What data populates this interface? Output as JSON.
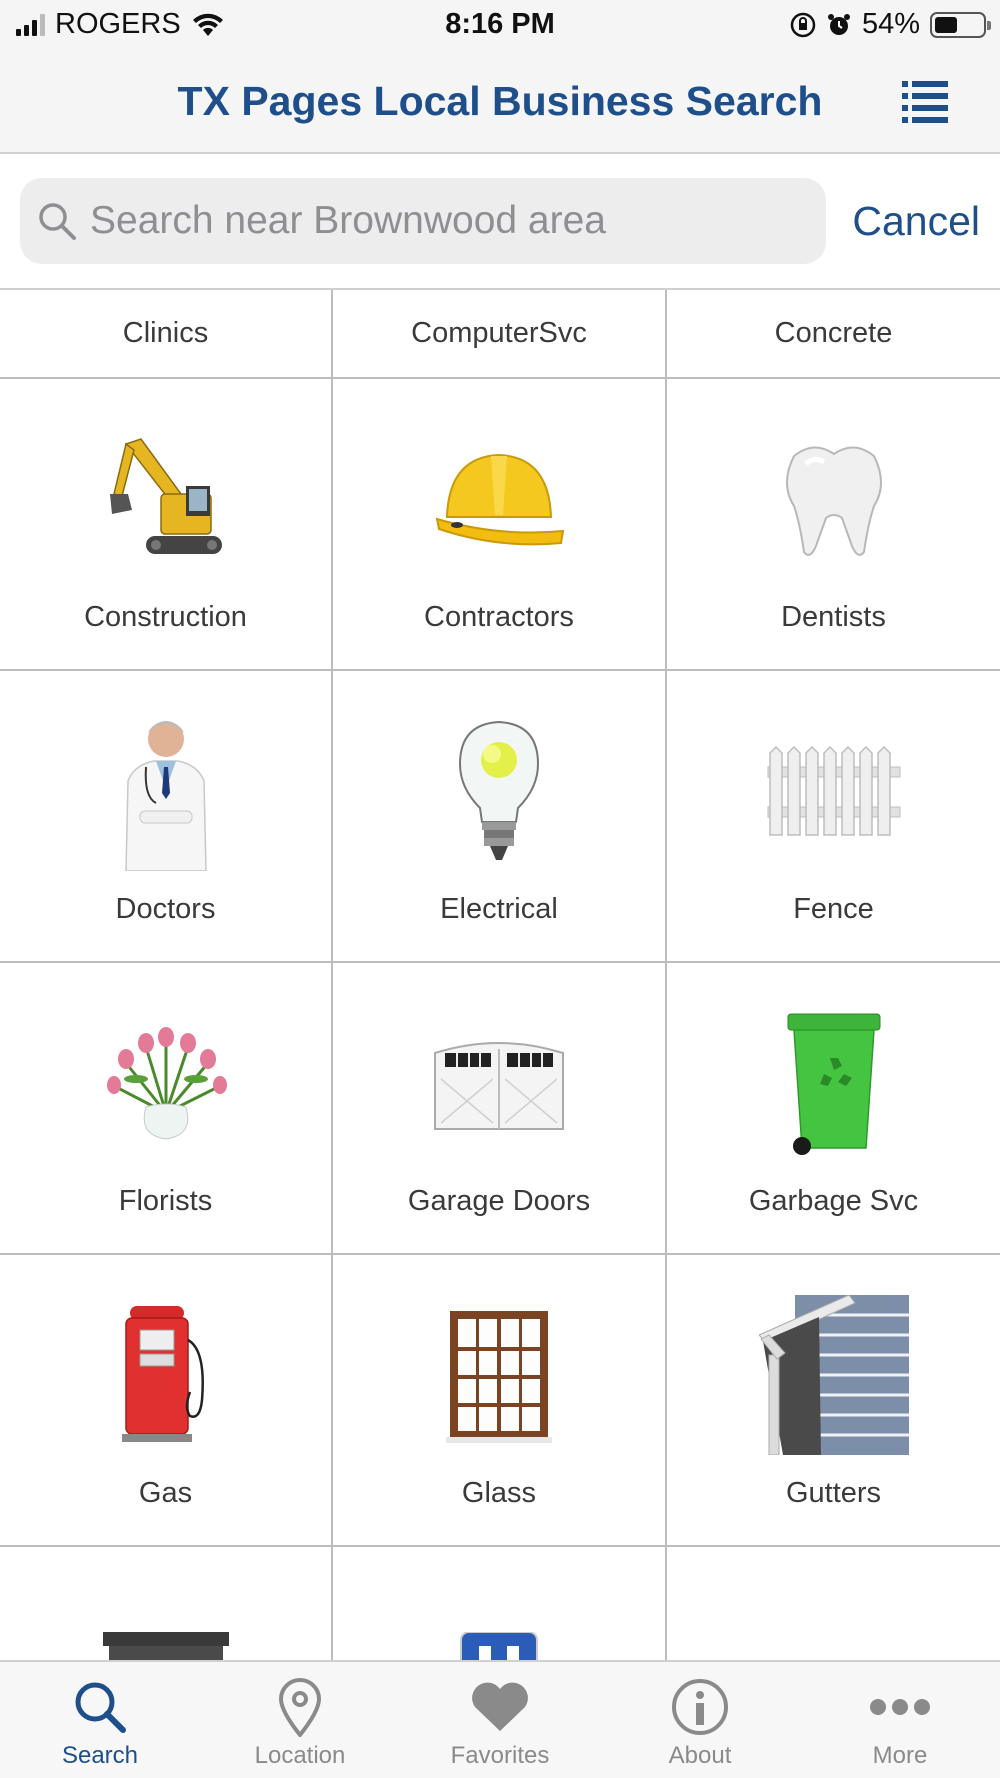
{
  "status_bar": {
    "carrier": "ROGERS",
    "time": "8:16 PM",
    "battery": "54%"
  },
  "nav": {
    "title": "TX Pages Local Business Search"
  },
  "search": {
    "placeholder": "Search near Brownwood area",
    "value": "",
    "cancel_label": "Cancel"
  },
  "top_row": [
    "Clinics",
    "ComputerSvc",
    "Concrete"
  ],
  "categories": [
    {
      "label": "Construction",
      "icon": "excavator-icon"
    },
    {
      "label": "Contractors",
      "icon": "hard-hat-icon"
    },
    {
      "label": "Dentists",
      "icon": "tooth-icon"
    },
    {
      "label": "Doctors",
      "icon": "doctor-icon"
    },
    {
      "label": "Electrical",
      "icon": "light-bulb-icon"
    },
    {
      "label": "Fence",
      "icon": "fence-icon"
    },
    {
      "label": "Florists",
      "icon": "flowers-icon"
    },
    {
      "label": "Garage Doors",
      "icon": "garage-door-icon"
    },
    {
      "label": "Garbage Svc",
      "icon": "garbage-bin-icon"
    },
    {
      "label": "Gas",
      "icon": "gas-pump-icon"
    },
    {
      "label": "Glass",
      "icon": "window-icon"
    },
    {
      "label": "Gutters",
      "icon": "gutter-icon"
    },
    {
      "label": "",
      "icon": "fireplace-icon"
    },
    {
      "label": "",
      "icon": "hospital-sign-icon"
    },
    {
      "label": "",
      "icon": "furniture-icon"
    }
  ],
  "tabs": [
    {
      "label": "Search",
      "icon": "search-icon",
      "active": true
    },
    {
      "label": "Location",
      "icon": "location-pin-icon",
      "active": false
    },
    {
      "label": "Favorites",
      "icon": "heart-icon",
      "active": false
    },
    {
      "label": "About",
      "icon": "info-icon",
      "active": false
    },
    {
      "label": "More",
      "icon": "more-dots-icon",
      "active": false
    }
  ],
  "colors": {
    "accent": "#1e4f8a",
    "tab_inactive": "#8a8a8a",
    "bar_background": "#f5f5f5",
    "grid_line": "#bdbdbd"
  }
}
